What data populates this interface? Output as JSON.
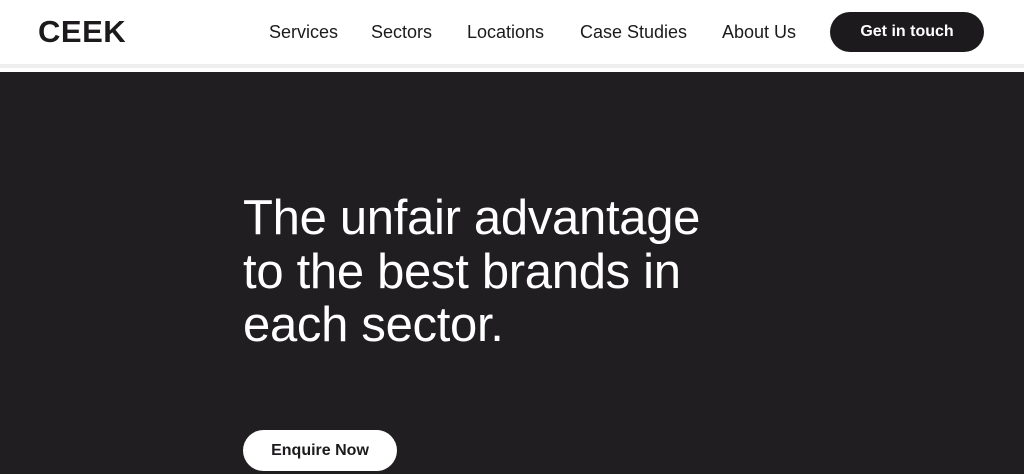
{
  "header": {
    "logo": "CEEK",
    "nav": [
      {
        "label": "Services"
      },
      {
        "label": "Sectors"
      },
      {
        "label": "Locations"
      },
      {
        "label": "Case Studies"
      },
      {
        "label": "About Us"
      }
    ],
    "cta_label": "Get in touch"
  },
  "hero": {
    "title": "The unfair advantage to the best brands in each sector.",
    "button_label": "Enquire Now"
  },
  "colors": {
    "dark": "#211e21",
    "text_dark": "#1c1a1c",
    "white": "#ffffff"
  }
}
